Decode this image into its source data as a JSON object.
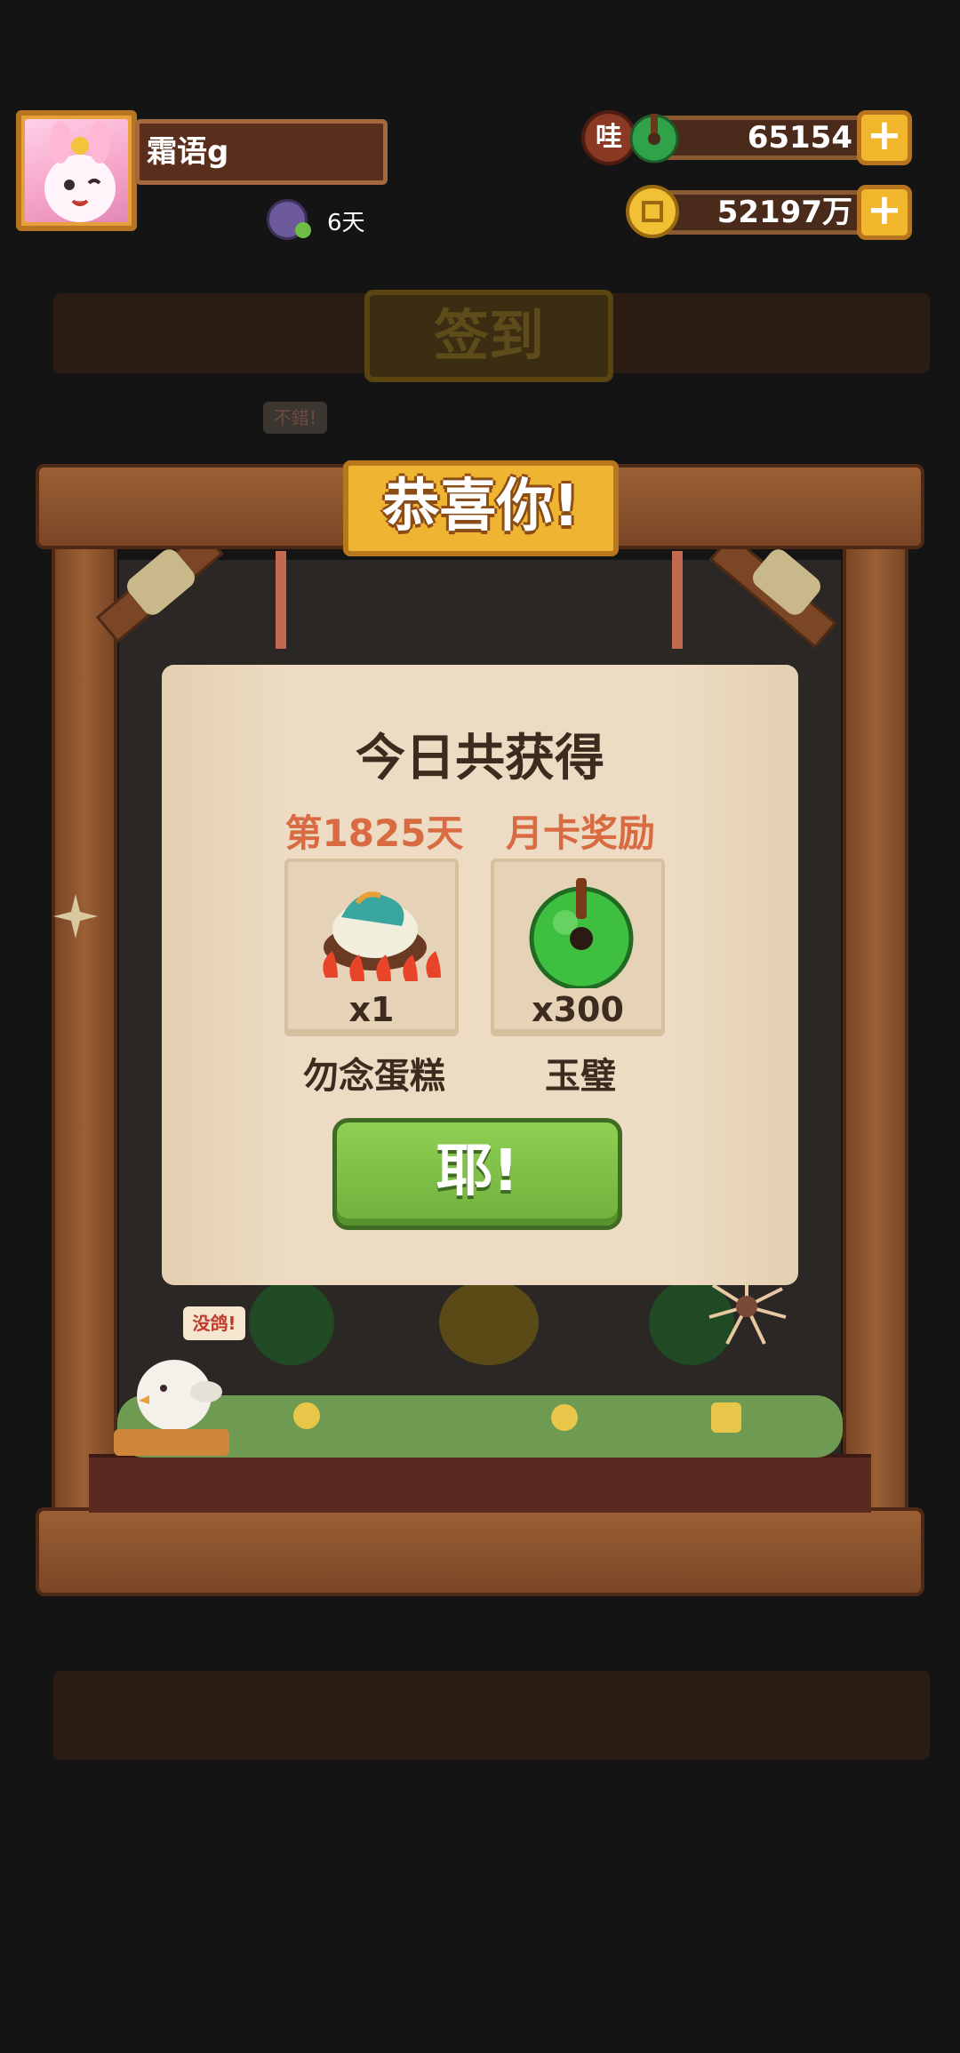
{
  "player": {
    "name": "霜语g",
    "streak_days": "6天"
  },
  "currencies": [
    {
      "name": "jade",
      "value": "65154",
      "badge": "哇",
      "icon": "jade-disc-icon"
    },
    {
      "name": "coin",
      "value": "52197万",
      "icon": "coin-icon"
    }
  ],
  "background": {
    "checkin_title": "签到",
    "bubble_top": "不錯!"
  },
  "frame": {
    "title": "恭喜你!"
  },
  "reward_modal": {
    "title": "今日共获得",
    "columns": [
      {
        "label": "第1825天",
        "qty": "x1",
        "item": "勿念蛋糕",
        "icon": "cake-icon"
      },
      {
        "label": "月卡奖励",
        "qty": "x300",
        "item": "玉璧",
        "icon": "jade-disc-icon"
      }
    ],
    "confirm": "耶!"
  },
  "chick": {
    "bubble": "没鸽!"
  },
  "colors": {
    "accent_gold": "#f0b433",
    "wood": "#8a5230",
    "confirm_green": "#79bd45",
    "reward_red": "#d96b43"
  }
}
